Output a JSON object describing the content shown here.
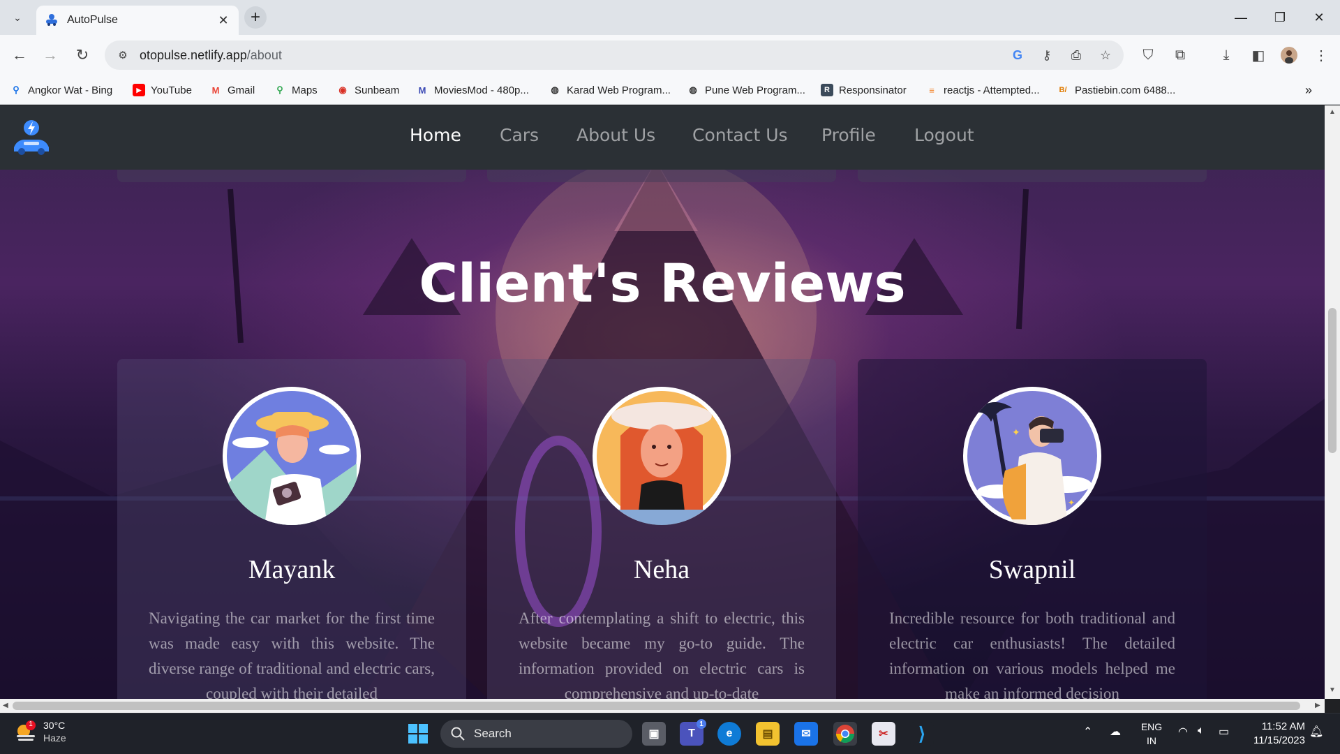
{
  "browser": {
    "tab_title": "AutoPulse",
    "url_host": "otopulse.netlify.app",
    "url_path": "/about",
    "bookmarks": [
      {
        "label": "Angkor Wat - Bing",
        "icon": "search-icon",
        "color": "#1a73e8"
      },
      {
        "label": "YouTube",
        "icon": "youtube-icon",
        "color": "#ff0000"
      },
      {
        "label": "Gmail",
        "icon": "gmail-icon",
        "color": "#ea4335"
      },
      {
        "label": "Maps",
        "icon": "maps-pin-icon",
        "color": "#34a853"
      },
      {
        "label": "Sunbeam",
        "icon": "sunbeam-icon",
        "color": "#d93025"
      },
      {
        "label": "MoviesMod - 480p...",
        "icon": "moviesmod-icon",
        "color": "#3c4ab5"
      },
      {
        "label": "Karad Web Program...",
        "icon": "globe-icon",
        "color": "#333333"
      },
      {
        "label": "Pune Web Program...",
        "icon": "globe-icon",
        "color": "#333333"
      },
      {
        "label": "Responsinator",
        "icon": "responsinator-icon",
        "color": "#3b4a5a"
      },
      {
        "label": "reactjs - Attempted...",
        "icon": "stackoverflow-icon",
        "color": "#f48024"
      },
      {
        "label": "Pastiebin.com 6488...",
        "icon": "pastiebin-icon",
        "color": "#e07b00"
      }
    ]
  },
  "site": {
    "nav": {
      "links": [
        "Home",
        "Cars",
        "About Us",
        "Contact Us",
        "Profile",
        "Logout"
      ],
      "active": "Home"
    },
    "reviews_title": "Client's Reviews",
    "reviews": [
      {
        "name": "Mayank",
        "text": "Navigating the car market for the first time was made easy with this website. The diverse range of traditional and electric cars, coupled with their detailed"
      },
      {
        "name": "Neha",
        "text": "After contemplating a shift to electric, this website became my go-to guide. The information provided on electric cars is comprehensive and up-to-date"
      },
      {
        "name": "Swapnil",
        "text": "Incredible resource for both traditional and electric car enthusiasts! The detailed information on various models helped me make an informed decision"
      }
    ]
  },
  "taskbar": {
    "weather_temp": "30°C",
    "weather_desc": "Haze",
    "weather_badge": "1",
    "search_label": "Search",
    "teams_badge": "1",
    "lang_line1": "ENG",
    "lang_line2": "IN",
    "time": "11:52 AM",
    "date": "11/15/2023"
  },
  "colors": {
    "navbar_bg": "#2b3035",
    "page_accent": "#4a2460",
    "taskbar_bg": "#1f2229"
  }
}
